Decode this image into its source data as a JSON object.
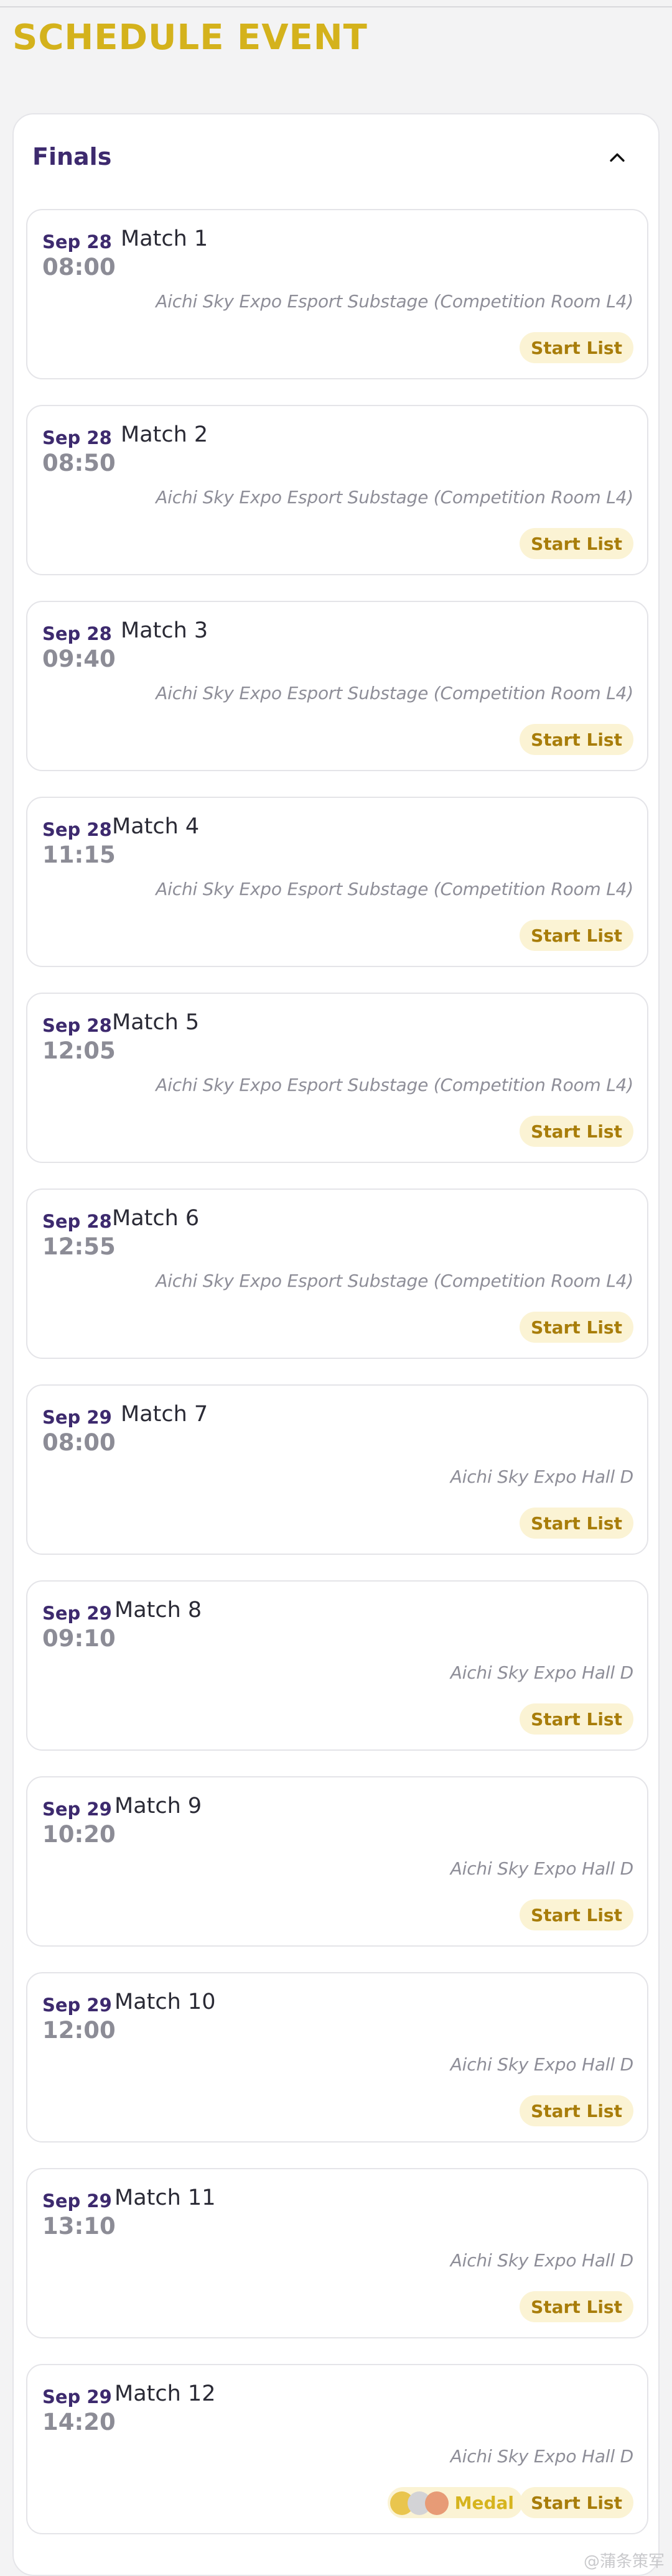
{
  "page": {
    "title": "SCHEDULE EVENT"
  },
  "section": {
    "title": "Finals",
    "toggle_icon": "chevron-up-icon"
  },
  "start_list_label": "Start List",
  "medal_label": "Medal",
  "medal_colors": {
    "gold": "#e9c54e",
    "silver": "#d3d3d6",
    "bronze": "#e79b76"
  },
  "colors": {
    "title": "#d4b21c",
    "date": "#3d2a6e",
    "time": "#8c8c96",
    "venue": "#8e8e98",
    "button_bg": "#fbf3d4",
    "button_text": "#a87d0a"
  },
  "matches": [
    {
      "date": "Sep 28",
      "name": "Match 1",
      "time": "08:00",
      "venue": "Aichi Sky Expo Esport Substage (Competition Room L4)"
    },
    {
      "date": "Sep 28",
      "name": "Match 2",
      "time": "08:50",
      "venue": "Aichi Sky Expo Esport Substage (Competition Room L4)"
    },
    {
      "date": "Sep 28",
      "name": "Match 3",
      "time": "09:40",
      "venue": "Aichi Sky Expo Esport Substage (Competition Room L4)"
    },
    {
      "date": "Sep 28",
      "name": "Match 4",
      "time": "11:15",
      "venue": "Aichi Sky Expo Esport Substage (Competition Room L4)"
    },
    {
      "date": "Sep 28",
      "name": "Match 5",
      "time": "12:05",
      "venue": "Aichi Sky Expo Esport Substage (Competition Room L4)"
    },
    {
      "date": "Sep 28",
      "name": "Match 6",
      "time": "12:55",
      "venue": "Aichi Sky Expo Esport Substage (Competition Room L4)"
    },
    {
      "date": "Sep 29",
      "name": "Match 7",
      "time": "08:00",
      "venue": "Aichi Sky Expo Hall D"
    },
    {
      "date": "Sep 29",
      "name": "Match 8",
      "time": "09:10",
      "venue": "Aichi Sky Expo Hall D"
    },
    {
      "date": "Sep 29",
      "name": "Match 9",
      "time": "10:20",
      "venue": "Aichi Sky Expo Hall D"
    },
    {
      "date": "Sep 29",
      "name": "Match 10",
      "time": "12:00",
      "venue": "Aichi Sky Expo Hall D"
    },
    {
      "date": "Sep 29",
      "name": "Match 11",
      "time": "13:10",
      "venue": "Aichi Sky Expo Hall D"
    },
    {
      "date": "Sep 29",
      "name": "Match 12",
      "time": "14:20",
      "venue": "Aichi Sky Expo Hall D"
    }
  ],
  "watermark": "@蒲条策军"
}
